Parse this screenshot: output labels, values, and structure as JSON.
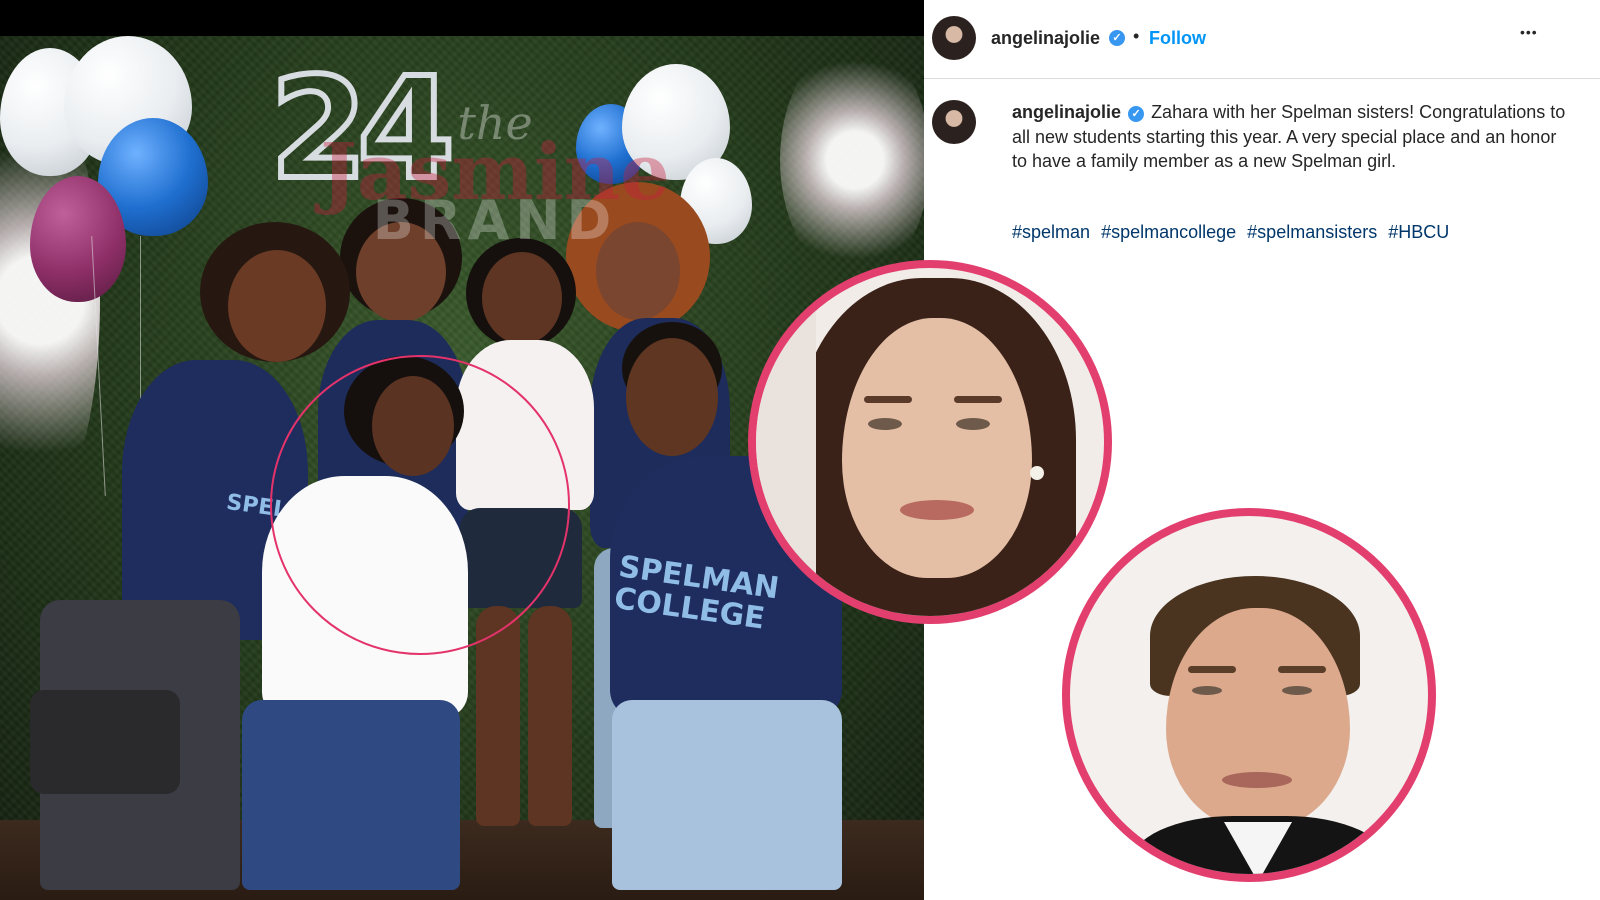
{
  "post": {
    "username": "angelinajolie",
    "verified_mark": "✓",
    "separator": "•",
    "follow_label": "Follow",
    "more_label": "•••",
    "caption": "Zahara with her Spelman sisters! Congratulations to all new students starting this year. A very special place and an honor to have a family member as a new Spelman girl.",
    "hashtags": [
      "#spelman",
      "#spelmancollege",
      "#spelmansisters",
      "#HBCU"
    ]
  },
  "watermark": {
    "line1": "the",
    "line2": "Jasmine",
    "line3": "BRAND"
  },
  "photo": {
    "balloon_number": "24",
    "shirt_text_left": "SPELMAN",
    "shirt_text_right": "SPELMAN COLLEGE"
  },
  "colors": {
    "accent_ring": "#e23f6f",
    "follow": "#0095f6",
    "hashtag": "#00376b",
    "verified": "#3897f0"
  },
  "icons": [
    "verified-badge-icon",
    "more-options-icon"
  ]
}
